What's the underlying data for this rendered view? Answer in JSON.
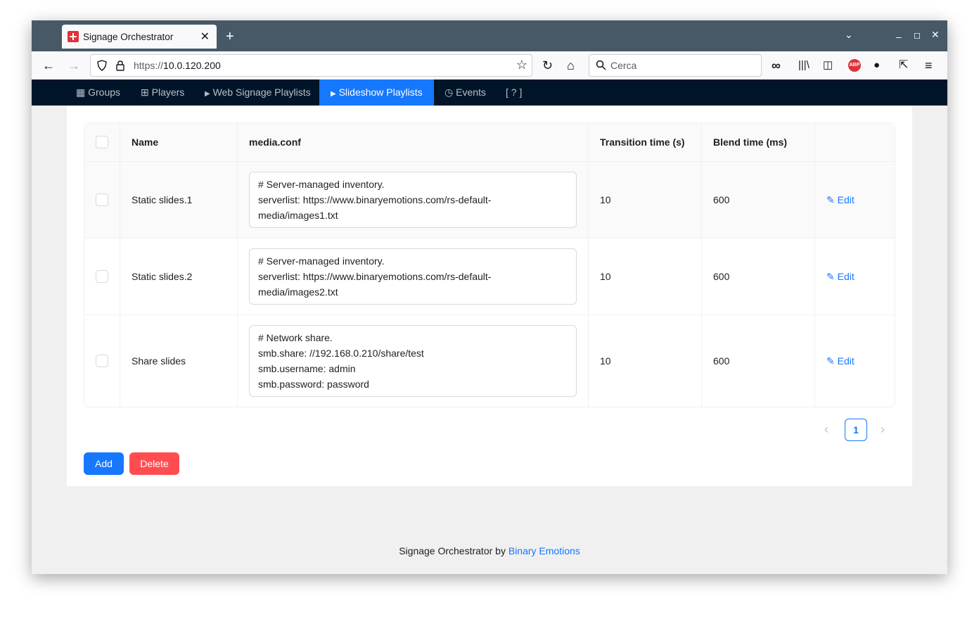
{
  "browser": {
    "tab_title": "Signage Orchestrator",
    "tab_close": "✕",
    "new_tab": "+",
    "url_scheme": "https://",
    "url_host": "10.0.120.200",
    "search_placeholder": "Cerca",
    "window_controls": [
      "⌄",
      "_",
      "◻",
      "✕"
    ]
  },
  "appnav": {
    "items": [
      {
        "label": "Groups",
        "icon": "▦"
      },
      {
        "label": "Players",
        "icon": "⊞"
      },
      {
        "label": "Web Signage Playlists",
        "icon": "▶"
      },
      {
        "label": "Slideshow Playlists",
        "icon": "▶",
        "active": true
      },
      {
        "label": "Events",
        "icon": "◷"
      },
      {
        "label": "[ ? ]",
        "icon": ""
      }
    ]
  },
  "table": {
    "columns": [
      "Name",
      "media.conf",
      "Transition time (s)",
      "Blend time (ms)"
    ],
    "rows": [
      {
        "name": "Static slides.1",
        "conf": "# Server-managed inventory.\nserverlist: https://www.binaryemotions.com/rs-default-\nmedia/images1.txt",
        "transition": "10",
        "blend": "600",
        "edit": "Edit"
      },
      {
        "name": "Static slides.2",
        "conf": "# Server-managed inventory.\nserverlist: https://www.binaryemotions.com/rs-default-\nmedia/images2.txt",
        "transition": "10",
        "blend": "600",
        "edit": "Edit"
      },
      {
        "name": "Share slides",
        "conf": "# Network share.\nsmb.share: //192.168.0.210/share/test\nsmb.username: admin\nsmb.password: password",
        "transition": "10",
        "blend": "600",
        "edit": "Edit"
      }
    ]
  },
  "pagination": {
    "prev": "‹",
    "current": "1",
    "next": "›"
  },
  "actions": {
    "add": "Add",
    "delete": "Delete"
  },
  "footer": {
    "text": "Signage Orchestrator by ",
    "link": "Binary Emotions"
  },
  "colors": {
    "primary": "#1677ff",
    "danger": "#ff4d4f",
    "nav_bg": "#001529",
    "tabbar_bg": "#475966"
  }
}
